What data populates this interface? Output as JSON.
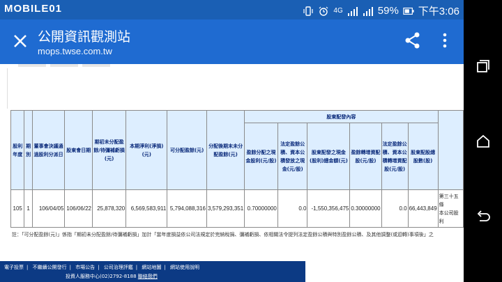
{
  "status_bar": {
    "brand": "MOBILE01",
    "network": "4G",
    "battery": "59%",
    "time": "下午3:06"
  },
  "app_bar": {
    "title": "公開資訊觀測站",
    "url": "mops.twse.com.tw"
  },
  "table": {
    "group_header": "股東配發內容",
    "headers": {
      "year": "股利年度",
      "period": "期別",
      "board_date": "董事會決議通過股利分派日",
      "meeting_date": "股東會日期",
      "beginning_undistributed": "期初未分配盈餘/待彌補虧損(元)",
      "net_income": "本期淨利(淨損)(元)",
      "distributable": "可分配盈餘(元)",
      "ending_undistributed": "分配後期末未分配盈餘(元)",
      "cash_from_earnings": "盈餘分配之現金股利(元/股)",
      "cash_from_reserve": "法定盈餘公積、資本公積發放之現金(元/股)",
      "total_cash": "股東配發之現金(股利)總金額(元)",
      "stock_from_earnings": "盈餘轉增資配股(元/股)",
      "stock_from_reserve": "法定盈餘公積、資本公積轉增資配股(元/股)",
      "total_stock": "股東配股總股數(股)"
    },
    "row": {
      "year": "105",
      "period": "1",
      "board_date": "106/04/05",
      "meeting_date": "106/06/22",
      "beginning_undistributed": "25,878,320",
      "net_income": "6,569,583,911",
      "distributable": "5,794,088,316",
      "ending_undistributed": "3,579,293,351",
      "cash_from_earnings": "0.70000000",
      "cash_from_reserve": "0.0",
      "total_cash": "-1,550,356,475",
      "stock_from_earnings": "0.30000000",
      "stock_from_reserve": "0.0",
      "total_stock": "66,443,849",
      "remark": "第三十五條\n本公司股利"
    }
  },
  "note": "註：「可分配盈餘(元)」係指「期初未分配盈餘/待彌補虧損」加計「當年度損益依公司法規定於完納稅捐、彌補虧損、依相關法令提列法定盈餘公積與特別盈餘公積、及其他調整(或迴轉)事項後」之",
  "footer": {
    "links": [
      "電子投票",
      "不繼續公開發行",
      "市場公告",
      "公司治理評鑑",
      "網站地圖",
      "網站使用說明"
    ],
    "contact_prefix": "投資人服務中心(02)2792-8188",
    "contact_link": "聯絡我們"
  }
}
